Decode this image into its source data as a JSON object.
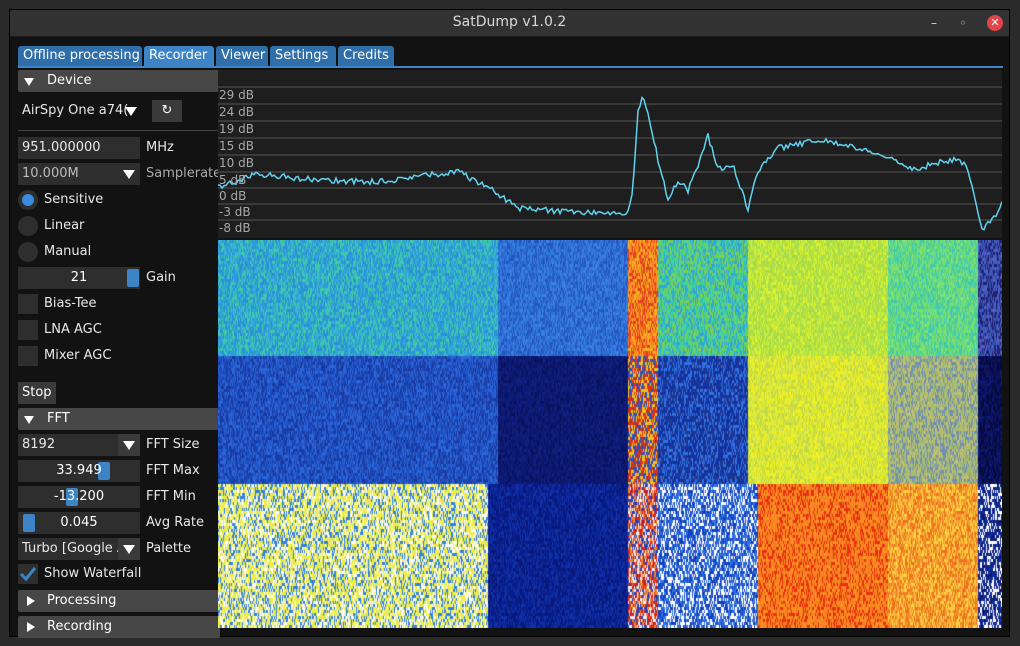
{
  "window": {
    "title": "SatDump v1.0.2"
  },
  "tabs": [
    {
      "label": "Offline processing"
    },
    {
      "label": "Recorder"
    },
    {
      "label": "Viewer"
    },
    {
      "label": "Settings"
    },
    {
      "label": "Credits"
    }
  ],
  "device": {
    "header": "Device",
    "source": "AirSpy One a74(",
    "frequency": "951.000000",
    "frequency_unit": "MHz",
    "samplerate": "10.000M",
    "samplerate_label": "Samplerate",
    "modes": [
      {
        "label": "Sensitive",
        "selected": true
      },
      {
        "label": "Linear",
        "selected": false
      },
      {
        "label": "Manual",
        "selected": false
      }
    ],
    "gain_value": "21",
    "gain_label": "Gain",
    "bias_tee": "Bias-Tee",
    "lna_agc": "LNA AGC",
    "mixer_agc": "Mixer AGC",
    "stop": "Stop"
  },
  "fft": {
    "header": "FFT",
    "size": "8192",
    "size_label": "FFT Size",
    "max": "33.949",
    "max_label": "FFT Max",
    "min": "-13.200",
    "min_label": "FFT Min",
    "avg_rate": "0.045",
    "avg_rate_label": "Avg Rate",
    "palette": "Turbo [Google A",
    "palette_label": "Palette",
    "show_waterfall": "Show Waterfall"
  },
  "processing": {
    "header": "Processing"
  },
  "recording": {
    "header": "Recording"
  },
  "spectrum": {
    "db_labels": [
      "29 dB",
      "24 dB",
      "19 dB",
      "15 dB",
      "10 dB",
      "5 dB",
      "0 dB",
      "-3 dB",
      "-8 dB"
    ],
    "colors": {
      "trace": "#5fd3f0",
      "grid": "#555555",
      "background": "#1e1e1e"
    }
  },
  "colors": {
    "accent": "#3d84c6",
    "tab": "#2f6ea8"
  }
}
